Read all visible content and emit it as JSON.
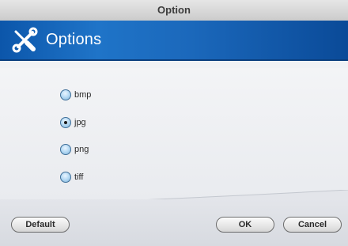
{
  "window": {
    "title": "Option"
  },
  "banner": {
    "title": "Options",
    "icon": "tools-icon"
  },
  "format_options": [
    {
      "label": "bmp",
      "checked": false
    },
    {
      "label": "jpg",
      "checked": true
    },
    {
      "label": "png",
      "checked": false
    },
    {
      "label": "tiff",
      "checked": false
    }
  ],
  "buttons": {
    "default_label": "Default",
    "ok_label": "OK",
    "cancel_label": "Cancel"
  },
  "colors": {
    "banner_blue": "#1f74c8",
    "banner_dark": "#0a4a98"
  }
}
